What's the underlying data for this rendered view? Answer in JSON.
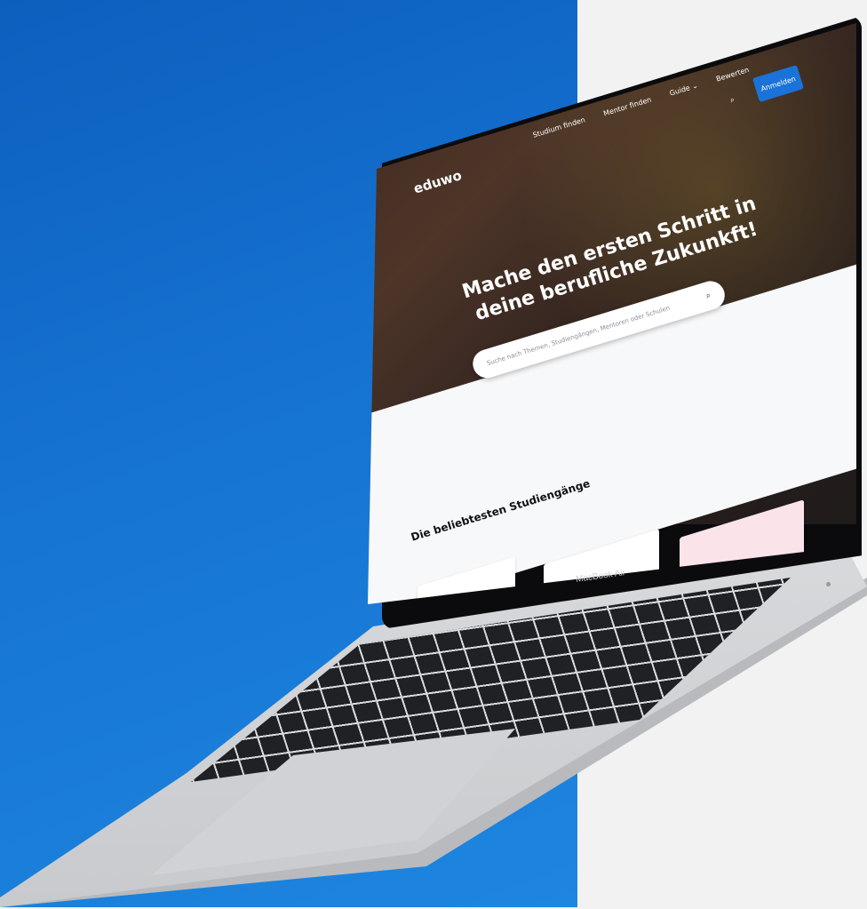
{
  "site": {
    "brand": "eduwo",
    "nav": {
      "items": [
        "Studium finden",
        "Mentor finden",
        "Guide",
        "Bewerten"
      ],
      "login_button": "Anmelden"
    },
    "hero": {
      "headline": "Mache den ersten Schritt in deine berufliche Zukunkft!",
      "search_placeholder": "Suche nach Themen, Studiengängen, Mentoren oder Schulen"
    },
    "sections": {
      "popular_title": "Die beliebtesten Studiengänge"
    }
  },
  "device": {
    "label": "MacBook Air"
  },
  "colors": {
    "background_blue": "#1673d1",
    "accent": "#1a73d9"
  }
}
